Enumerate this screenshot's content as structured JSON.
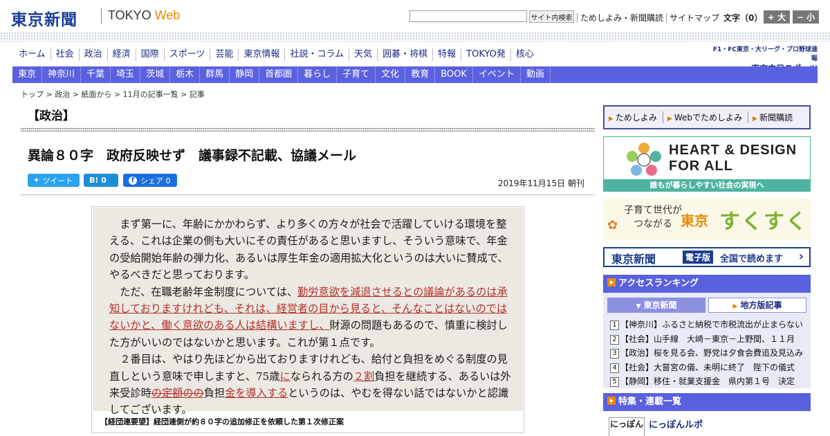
{
  "header": {
    "logo": "東京新聞",
    "tokyo": "TOKYO",
    "web": "Web",
    "search_button": "サイト内検索",
    "links": [
      "ためしよみ・新聞購読",
      "サイトマップ"
    ],
    "font_size_label": "文字（0）",
    "font_large": "+ 大",
    "font_small": "− 小"
  },
  "main_nav": [
    "ホーム",
    "社会",
    "政治",
    "経済",
    "国際",
    "スポーツ",
    "芸能",
    "東京情報",
    "社説・コラム",
    "天気",
    "囲碁・将棋",
    "特報",
    "TOKYO発",
    "核心"
  ],
  "chunichi": {
    "top": "F1・FC東京・大リーグ・プロ野球速報",
    "main": "東京中日スポーツ"
  },
  "local_nav": [
    "東京",
    "神奈川",
    "千葉",
    "埼玉",
    "茨城",
    "栃木",
    "群馬",
    "静岡",
    "首都圏",
    "暮らし",
    "子育て",
    "文化",
    "教育",
    "BOOK",
    "イベント",
    "動画"
  ],
  "breadcrumb": "トップ > 政治 > 紙面から > 11月の記事一覧 > 記事",
  "article": {
    "section": "【政治】",
    "headline": "異論８０字　政府反映せず　議事録不記載、協議メール",
    "share": {
      "tweet": "ツイート",
      "hatena": "B! 0",
      "facebook": "シェア 0"
    },
    "dateline": "2019年11月15日 朝刊",
    "figure": {
      "p1": "まず第一に、年齢にかかわらず、より多くの方々が社会で活躍していける環境を整える、これは企業の側も大いにその責任があると思いますし、そういう意味で、年金の受給開始年齢の弾力化、あるいは厚生年金の適用拡大化というのは大いに賛成で、やるべきだと思っております。",
      "p2a": "ただ、在職老齢年金制度については、",
      "p2red": "勤労意欲を減退させるとの議論があるのは承知しておりますけれども、それは、経営者の目から見ると、そんなことはないのではないかと、働く意欲のある人は結構いますし、",
      "p2b": "財源の問題もあるので、慎重に検討した方がいいのではないかと思います。これが第１点です。",
      "p3a": "２番目は、やはり先ほどから出ておりますけれども、給付と負担をめぐる制度の見直しという意味で申しますと、75歳",
      "p3r1": "に",
      "p3b": "なられる方の",
      "p3r2": "２割",
      "p3c": "負担を継続する、あるいは外来受診時",
      "p3r3": "の定額のの",
      "p3d": "負担",
      "p3r4": "金を導入する",
      "p3e": "というのは、やむを得ない話ではないかと認識してございます。",
      "caption": "【経団連要望】経団連側が約８０字の追加修正を依頼した第１次修正案"
    }
  },
  "sidebar": {
    "promo": [
      "ためしよみ",
      "Webでためしよみ",
      "新聞購読"
    ],
    "heart_line1": "HEART & DESIGN",
    "heart_line2": "FOR ALL",
    "heart_sub": "誰もが暮らしやすい社会の実現へ",
    "suku_line1": "子育て世代が",
    "suku_line2": "つながる",
    "suku_tokyo": "東京",
    "suku_main": "すくすく",
    "epaper_logo": "東京新聞",
    "epaper_badge": "電子版",
    "epaper_text": "全国で読めます",
    "ranking_title": "アクセスランキング",
    "ranking_tabs": [
      "東京新聞",
      "地方版記事"
    ],
    "ranking": [
      {
        "num": "1",
        "text": "【神奈川】ふるさと納税で市税流出が止まらない"
      },
      {
        "num": "2",
        "text": "【社会】山手線　大崎－東京－上野間、１１月"
      },
      {
        "num": "3",
        "text": "【政治】桜を見る会、野党は夕食会費追及見込み"
      },
      {
        "num": "4",
        "text": "【社会】大嘗宮の儀、未明に終了　陛下の儀式"
      },
      {
        "num": "5",
        "text": "【静岡】移住・就業支援金　県内第１号　決定"
      }
    ],
    "feature_title": "特集・連載一覧",
    "feature_thumb": "にっぽん",
    "feature_item": "にっぽんルポ"
  }
}
